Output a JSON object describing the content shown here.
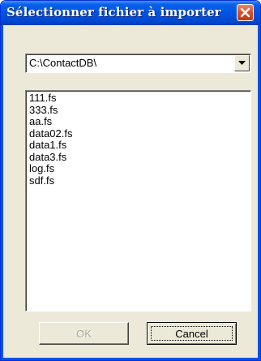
{
  "window": {
    "title": "Sélectionner fichier à importer",
    "close_icon": "close-icon",
    "accent": "#0054e3",
    "close_color": "#d8532a"
  },
  "directory_combo": {
    "value": "C:\\ContactDB\\",
    "arrow_icon": "chevron-down-icon"
  },
  "file_list": {
    "items": [
      "111.fs",
      "333.fs",
      "aa.fs",
      "data02.fs",
      "data1.fs",
      "data3.fs",
      "log.fs",
      "sdf.fs"
    ]
  },
  "buttons": {
    "ok_label": "OK",
    "ok_enabled": false,
    "cancel_label": "Cancel"
  }
}
